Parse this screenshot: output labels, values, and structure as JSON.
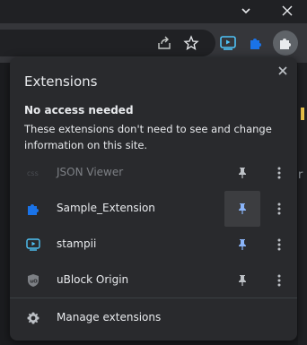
{
  "popup": {
    "title": "Extensions",
    "section_title": "No access needed",
    "section_desc": "These extensions don't need to see and change information on this site."
  },
  "extensions": [
    {
      "name": "JSON Viewer",
      "icon": "json-viewer-icon",
      "pinned": false,
      "disabled": true
    },
    {
      "name": "Sample_Extension",
      "icon": "puzzle-piece-icon",
      "pinned": true,
      "disabled": false
    },
    {
      "name": "stampii",
      "icon": "stampii-icon",
      "pinned": true,
      "disabled": false
    },
    {
      "name": "uBlock Origin",
      "icon": "ublock-origin-icon",
      "pinned": false,
      "disabled": false
    }
  ],
  "manage": {
    "label": "Manage extensions"
  },
  "colors": {
    "accent": "#8ab4f8",
    "puzzle": "#1a73e8",
    "stampii": "#4fc3f7",
    "popup_bg": "#292a2d"
  }
}
